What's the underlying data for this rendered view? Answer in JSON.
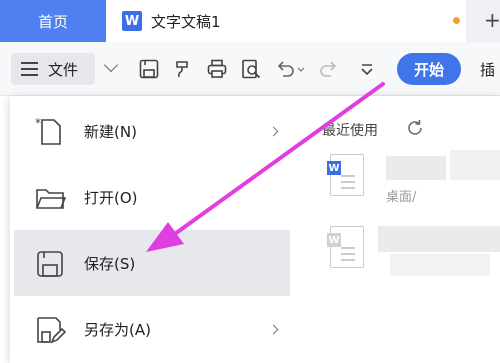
{
  "tabs": {
    "home_label": "首页",
    "doc_badge": "W",
    "doc_title": "文字文稿1",
    "new_tab": "+"
  },
  "toolbar": {
    "file_label": "文件",
    "start_label": "开始",
    "insert_label": "插"
  },
  "menu": {
    "items": [
      {
        "label": "新建(N)",
        "icon": "new-document-icon",
        "has_submenu": true
      },
      {
        "label": "打开(O)",
        "icon": "folder-icon",
        "has_submenu": false
      },
      {
        "label": "保存(S)",
        "icon": "save-icon",
        "has_submenu": false,
        "selected": true
      },
      {
        "label": "另存为(A)",
        "icon": "save-as-icon",
        "has_submenu": true
      }
    ]
  },
  "recent": {
    "title": "最近使用",
    "files": [
      {
        "badge": "W",
        "path": "桌面/"
      },
      {
        "badge": "W",
        "path": ""
      }
    ]
  },
  "colors": {
    "accent": "#3f74ea",
    "home_tab": "#4f7ff0",
    "unsaved_dot": "#f1a12a",
    "annotation_arrow": "#e13ee0"
  }
}
